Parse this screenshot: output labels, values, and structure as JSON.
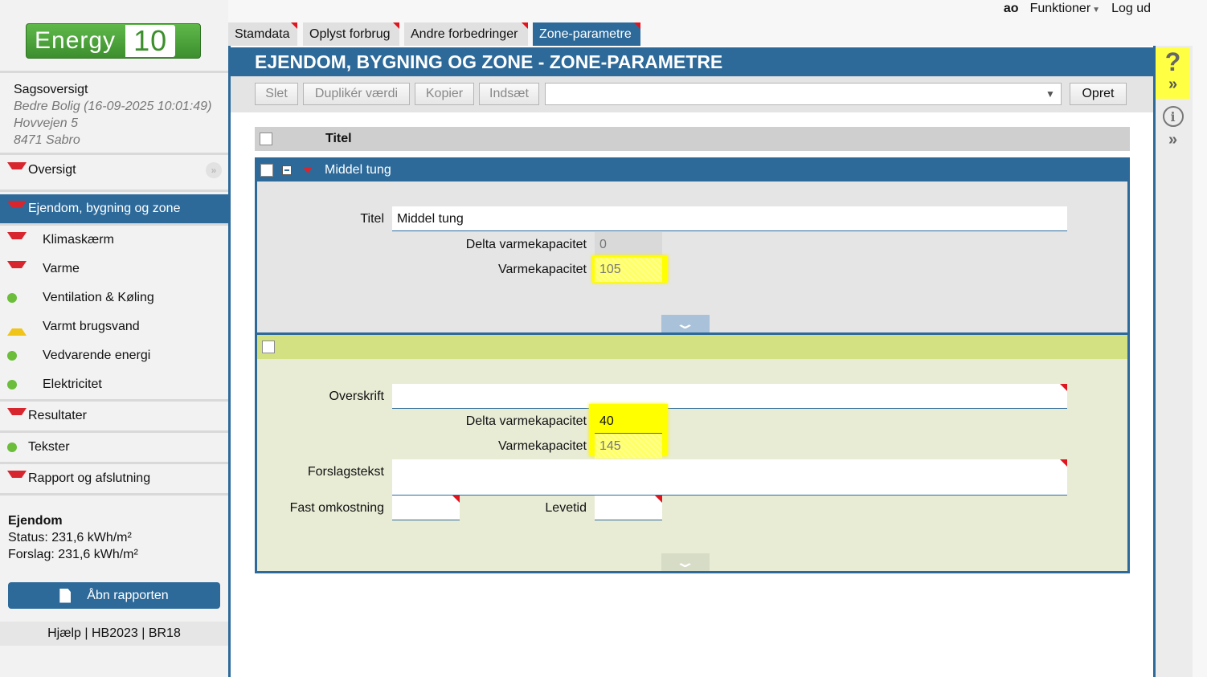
{
  "topbar": {
    "user": "ao",
    "functions": "Funktioner",
    "logout": "Log ud"
  },
  "logo": {
    "word": "Energy",
    "version": "10"
  },
  "case": {
    "heading": "Sagsoversigt",
    "lines": [
      "Bedre Bolig (16-09-2025 10:01:49)",
      "Hovvejen 5",
      "8471 Sabro"
    ]
  },
  "nav": [
    {
      "label": "Oversigt",
      "status": "red"
    },
    {
      "label": "Ejendom, bygning og zone",
      "status": "red",
      "active": true
    },
    {
      "label": "Klimaskærm",
      "status": "red"
    },
    {
      "label": "Varme",
      "status": "red"
    },
    {
      "label": "Ventilation & Køling",
      "status": "green"
    },
    {
      "label": "Varmt brugsvand",
      "status": "yellow"
    },
    {
      "label": "Vedvarende energi",
      "status": "green"
    },
    {
      "label": "Elektricitet",
      "status": "green"
    },
    {
      "label": "Resultater",
      "status": "red"
    },
    {
      "label": "Tekster",
      "status": "green"
    },
    {
      "label": "Rapport og afslutning",
      "status": "red"
    }
  ],
  "summary": {
    "heading": "Ejendom",
    "status": "Status: 231,6 kWh/m²",
    "proposal": "Forslag: 231,6 kWh/m²"
  },
  "open_report": "Åbn rapporten",
  "footer": "Hjælp | HB2023 | BR18",
  "tabs": [
    "Stamdata",
    "Oplyst forbrug",
    "Andre forbedringer",
    "Zone-parametre"
  ],
  "page_title": "EJENDOM, BYGNING OG ZONE - ZONE-PARAMETRE",
  "toolbar": {
    "delete": "Slet",
    "duplicate": "Duplikér værdi",
    "copy": "Kopier",
    "paste": "Indsæt",
    "select_value": "",
    "create": "Opret"
  },
  "list": {
    "column_title": "Titel"
  },
  "record1": {
    "header": "Middel tung",
    "title_label": "Titel",
    "title_value": "Middel tung",
    "delta_label": "Delta varmekapacitet",
    "delta_value": "0",
    "capacity_label": "Varmekapacitet",
    "capacity_value": "105"
  },
  "record2": {
    "heading_label": "Overskrift",
    "heading_value": "",
    "delta_label": "Delta varmekapacitet",
    "delta_value": "40",
    "capacity_label": "Varmekapacitet",
    "capacity_value": "145",
    "suggestion_label": "Forslagstekst",
    "suggestion_value": "",
    "fixed_cost_label": "Fast omkostning",
    "fixed_cost_value": "",
    "lifetime_label": "Levetid",
    "lifetime_value": ""
  },
  "rail": {
    "help": "?",
    "info": "i"
  },
  "colors": {
    "primary": "#2d6a9a",
    "highlight": "#ffff00",
    "new_record": "#d4e182",
    "flag": "#e0141e"
  }
}
